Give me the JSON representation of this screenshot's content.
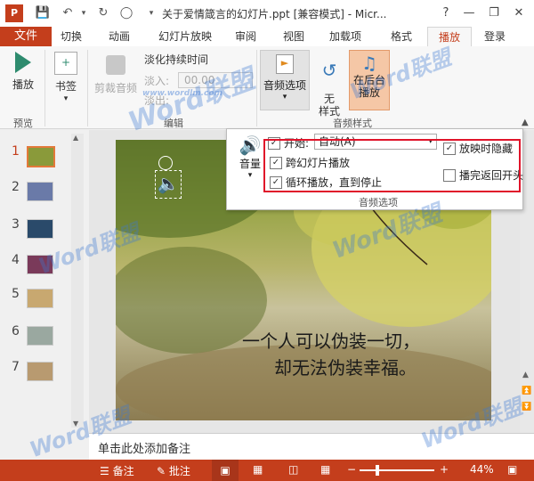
{
  "window": {
    "title": "关于爱情箴言的幻灯片.ppt [兼容模式] - Micr...",
    "help": "?",
    "minimize": "—",
    "restore": "❐",
    "close": "✕"
  },
  "tabs": [
    {
      "label": "文件"
    },
    {
      "label": "切换"
    },
    {
      "label": "动画"
    },
    {
      "label": "幻灯片放映"
    },
    {
      "label": "审阅"
    },
    {
      "label": "视图"
    },
    {
      "label": "加载项"
    },
    {
      "label": "格式"
    },
    {
      "label": "播放"
    },
    {
      "label": "登录"
    }
  ],
  "ribbon": {
    "preview": {
      "play": "播放",
      "group": "预览"
    },
    "bookmark": {
      "label": "书签"
    },
    "edit": {
      "trim": "剪裁音频",
      "fade_title": "淡化持续时间",
      "fade_in_label": "淡入:",
      "fade_in_value": "00.00",
      "fade_out_label": "淡出:",
      "group": "编辑"
    },
    "audio_options_btn": "音频选项",
    "styles": {
      "none": "无\n样式",
      "background": "在后台\n播放",
      "group": "音频样式"
    }
  },
  "popup": {
    "volume": "音量",
    "start_label": "开始:",
    "start_value": "自动(A)",
    "cross_slides": "跨幻灯片播放",
    "loop": "循环播放，直到停止",
    "hide": "放映时隐藏",
    "rewind": "播完返回开头",
    "group": "音频选项"
  },
  "slides": [
    {
      "num": "1",
      "color": "#8a9a3a"
    },
    {
      "num": "2",
      "color": "#6a7aa8"
    },
    {
      "num": "3",
      "color": "#2a4a6a"
    },
    {
      "num": "4",
      "color": "#7a3a5a"
    },
    {
      "num": "5",
      "color": "#c8a870"
    },
    {
      "num": "6",
      "color": "#9aa8a0"
    },
    {
      "num": "7",
      "color": "#b89a70"
    }
  ],
  "slide_text": {
    "line1": "一个人可以伪装一切，",
    "line2": "却无法伪装幸福。"
  },
  "notes_placeholder": "单击此处添加备注",
  "status": {
    "notes": "备注",
    "comments": "批注",
    "zoom": "44%"
  },
  "watermark": {
    "main": "Word联盟",
    "url": "www.wordlm.com"
  }
}
